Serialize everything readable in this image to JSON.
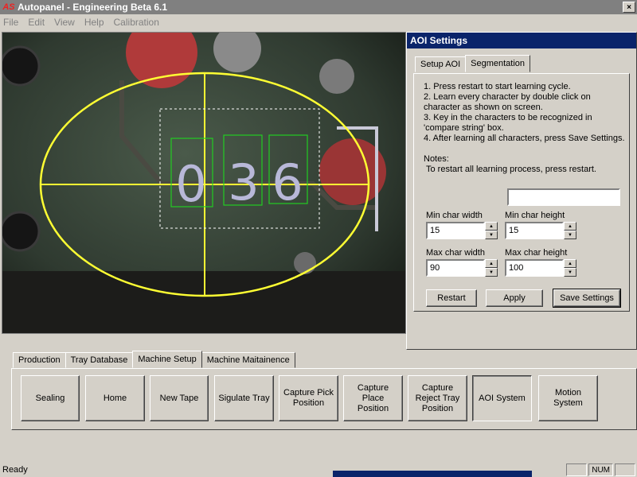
{
  "window": {
    "title": "Autopanel - Engineering Beta 6.1",
    "app_icon": "AS",
    "close": "×"
  },
  "menu": [
    "File",
    "Edit",
    "View",
    "Help",
    "Calibration"
  ],
  "camera": {
    "characters": [
      "0",
      "3",
      "6"
    ],
    "colors": {
      "roi_ellipse": "#ffff33",
      "char_box": "#22cc22",
      "search_box": "#ffffff"
    }
  },
  "aoi_settings": {
    "title": "AOI Settings",
    "tabs": [
      {
        "label": "Setup AOI",
        "active": false
      },
      {
        "label": "Segmentation",
        "active": true
      }
    ],
    "instructions": [
      "1. Press restart to start learning cycle.",
      "2. Learn every character by double click on character as shown on screen.",
      "3. Key in the characters to be recognized in 'compare string' box.",
      "4. After learning all characters, press Save Settings."
    ],
    "notes_label": "Notes:",
    "notes_text": "To restart all learning process, press restart.",
    "compare_string": "",
    "fields": {
      "min_char_width": {
        "label": "Min char width",
        "value": "15"
      },
      "min_char_height": {
        "label": "Min char height",
        "value": "15"
      },
      "max_char_width": {
        "label": "Max char width",
        "value": "90"
      },
      "max_char_height": {
        "label": "Max char height",
        "value": "100"
      }
    },
    "buttons": {
      "restart": "Restart",
      "apply": "Apply",
      "save_settings": "Save Settings"
    }
  },
  "main_tabs": [
    {
      "label": "Production",
      "active": false
    },
    {
      "label": "Tray Database",
      "active": false
    },
    {
      "label": "Machine Setup",
      "active": true
    },
    {
      "label": "Machine Maitainence",
      "active": false
    }
  ],
  "machine_buttons": {
    "sealing": "Sealing",
    "home": "Home",
    "new_tape": "New Tape",
    "sigulate_tray": "Sigulate Tray",
    "capture_pick": "Capture Pick Position",
    "capture_place": "Capture Place Position",
    "capture_reject": "Capture Reject Tray Position",
    "aoi_system": "AOI System",
    "motion_system": "Motion System"
  },
  "status": {
    "text": "Ready",
    "num": "NUM"
  }
}
